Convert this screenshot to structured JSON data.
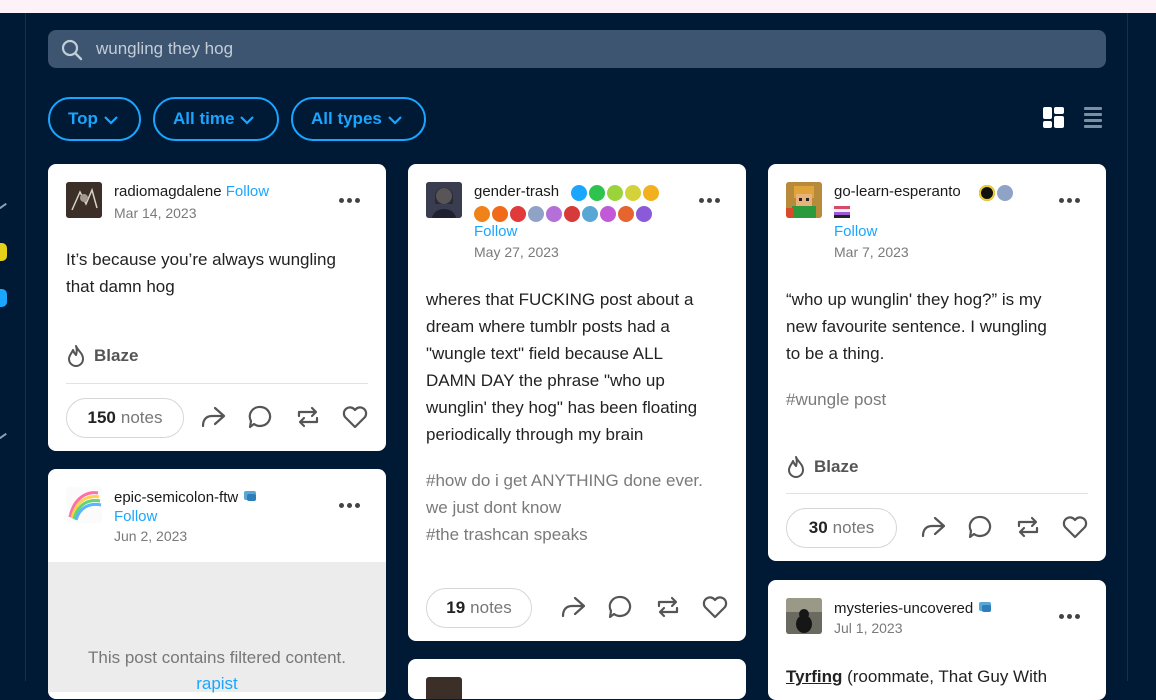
{
  "search": {
    "query": "wungling they hog"
  },
  "filters": [
    {
      "label": "Top"
    },
    {
      "label": "All time"
    },
    {
      "label": "All types"
    }
  ],
  "posts": {
    "p1": {
      "username": "radiomagdalene",
      "follow": "Follow",
      "date": "Mar 14, 2023",
      "body": [
        "It’s because you’re always wungling",
        "that damn hog"
      ],
      "blaze": "Blaze",
      "notes_count": "150",
      "notes_label": "notes"
    },
    "p2": {
      "username": "epic-semicolon-ftw",
      "follow": "Follow",
      "date": "Jun 2, 2023",
      "filtered_message": "This post contains filtered content.",
      "filtered_word": "rapist"
    },
    "p3": {
      "username": "gender-trash",
      "follow": "Follow",
      "date": "May 27, 2023",
      "body": [
        "wheres that FUCKING post about a",
        "dream where tumblr posts had a",
        "\"wungle text\" field because ALL",
        "DAMN DAY the phrase \"who up",
        "wunglin' they hog\" has been floating",
        "periodically through my brain"
      ],
      "tags": [
        "#how do i get ANYTHING done ever.",
        "we just dont know",
        "#the trashcan speaks"
      ],
      "notes_count": "19",
      "notes_label": "notes"
    },
    "p4": {
      "username": "go-learn-esperanto",
      "follow": "Follow",
      "date": "Mar 7, 2023",
      "body": [
        "“who up wunglin' they hog?” is my",
        "new favourite sentence. I wungling",
        "to be a thing."
      ],
      "tags": [
        "#wungle post"
      ],
      "blaze": "Blaze",
      "notes_count": "30",
      "notes_label": "notes"
    },
    "p5": {
      "username": "mysteries-uncovered",
      "date": "Jul 1, 2023",
      "body_bold": "Tyrfing",
      "body_rest": " (roommate, That Guy With"
    }
  },
  "colors": {
    "background": "#001935",
    "accent": "#1aa6ff",
    "card": "#ffffff",
    "search": "#3d5570"
  }
}
